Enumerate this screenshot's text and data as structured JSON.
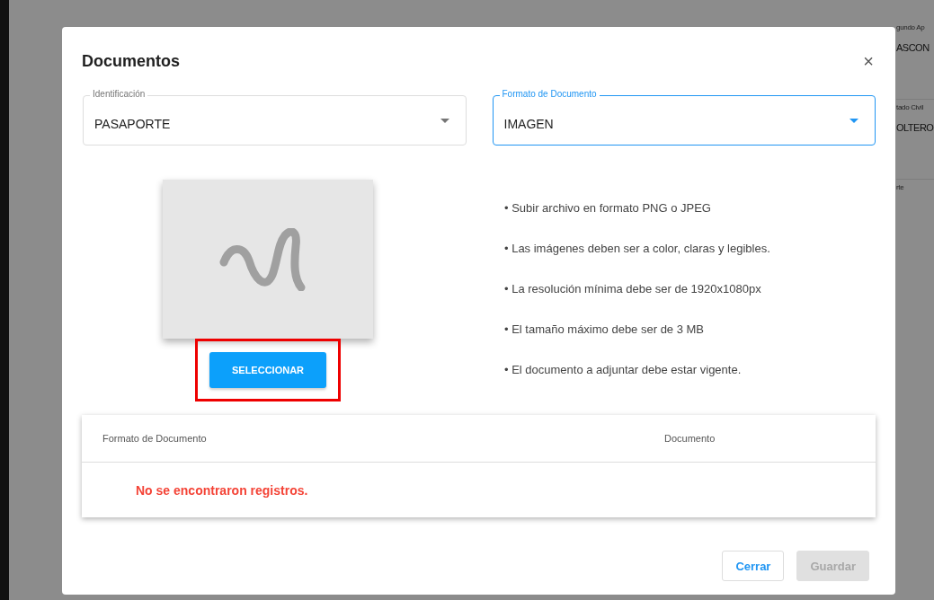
{
  "background": {
    "fields": [
      {
        "label": "gundo Ap",
        "value": "ASCON"
      },
      {
        "label": "tado Civil",
        "value": "OLTERO"
      },
      {
        "label": "rte"
      }
    ]
  },
  "dialog": {
    "title": "Documentos",
    "close": "×",
    "selects": [
      {
        "label": "Identificación",
        "value": "PASAPORTE",
        "focused": false
      },
      {
        "label": "Formato de Documento",
        "value": "IMAGEN",
        "focused": true
      }
    ],
    "upload": {
      "button": "SELECCIONAR",
      "highlighted": true
    },
    "instructions": [
      "• Subir archivo en formato PNG o JPEG",
      "• Las imágenes deben ser a color, claras y legibles.",
      "• La resolución mínima debe ser de 1920x1080px",
      "• El tamaño máximo debe ser de 3 MB",
      "• El documento a adjuntar debe estar vigente."
    ],
    "table": {
      "columns": [
        "Formato de Documento",
        "Documento"
      ],
      "empty_message": "No se encontraron registros."
    },
    "buttons": [
      {
        "label": "Cerrar",
        "disabled": false
      },
      {
        "label": "Guardar",
        "disabled": true
      }
    ]
  }
}
